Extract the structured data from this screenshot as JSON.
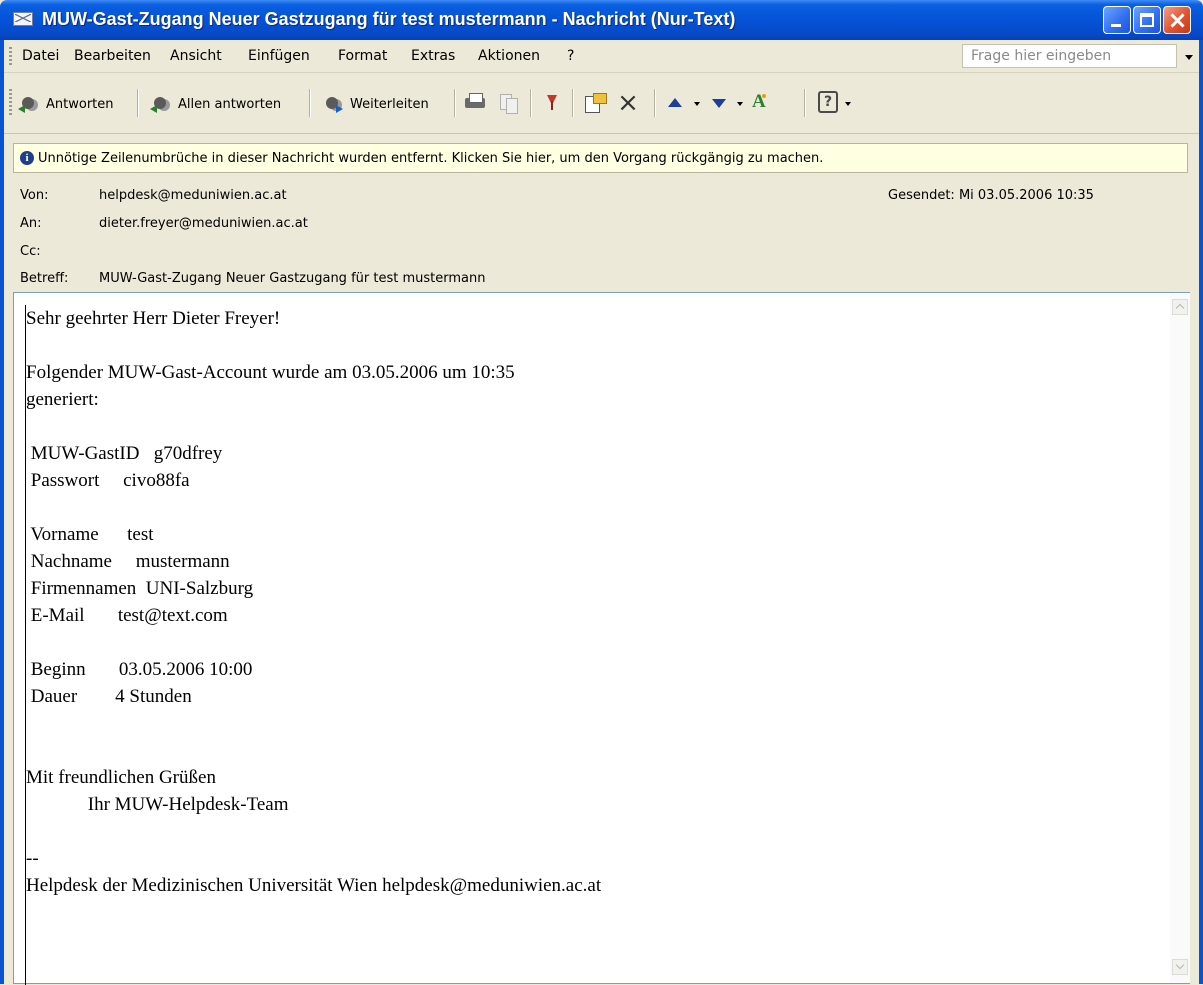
{
  "window": {
    "title": "MUW-Gast-Zugang Neuer Gastzugang für test mustermann - Nachricht (Nur-Text)"
  },
  "menu": {
    "items": [
      "Datei",
      "Bearbeiten",
      "Ansicht",
      "Einfügen",
      "Format",
      "Extras",
      "Aktionen",
      "?"
    ],
    "ask_placeholder": "Frage hier eingeben"
  },
  "toolbar": {
    "reply_label": "Antworten",
    "reply_all_label": "Allen antworten",
    "forward_label": "Weiterleiten"
  },
  "infobar": {
    "text": "Unnötige Zeilenumbrüche in dieser Nachricht wurden entfernt. Klicken Sie hier, um den Vorgang rückgängig zu machen."
  },
  "header": {
    "from_label": "Von:",
    "from_value": "helpdesk@meduniwien.ac.at",
    "to_label": "An:",
    "to_value": "dieter.freyer@meduniwien.ac.at",
    "cc_label": "Cc:",
    "cc_value": "",
    "subject_label": "Betreff:",
    "subject_value": "MUW-Gast-Zugang Neuer Gastzugang für test mustermann",
    "sent": "Gesendet: Mi 03.05.2006 10:35"
  },
  "body": {
    "lines": [
      "Sehr geehrter Herr Dieter Freyer!",
      "",
      "Folgender MUW-Gast-Account wurde am 03.05.2006 um 10:35",
      "generiert:",
      "",
      " MUW-GastID   g70dfrey",
      " Passwort     civo88fa",
      "",
      " Vorname      test",
      " Nachname     mustermann",
      " Firmennamen  UNI-Salzburg",
      " E-Mail       test@text.com",
      "",
      " Beginn       03.05.2006 10:00",
      " Dauer        4 Stunden",
      "",
      "",
      "Mit freundlichen Grüßen",
      "             Ihr MUW-Helpdesk-Team",
      "",
      "--",
      "Helpdesk der Medizinischen Universität Wien helpdesk@meduniwien.ac.at"
    ]
  }
}
